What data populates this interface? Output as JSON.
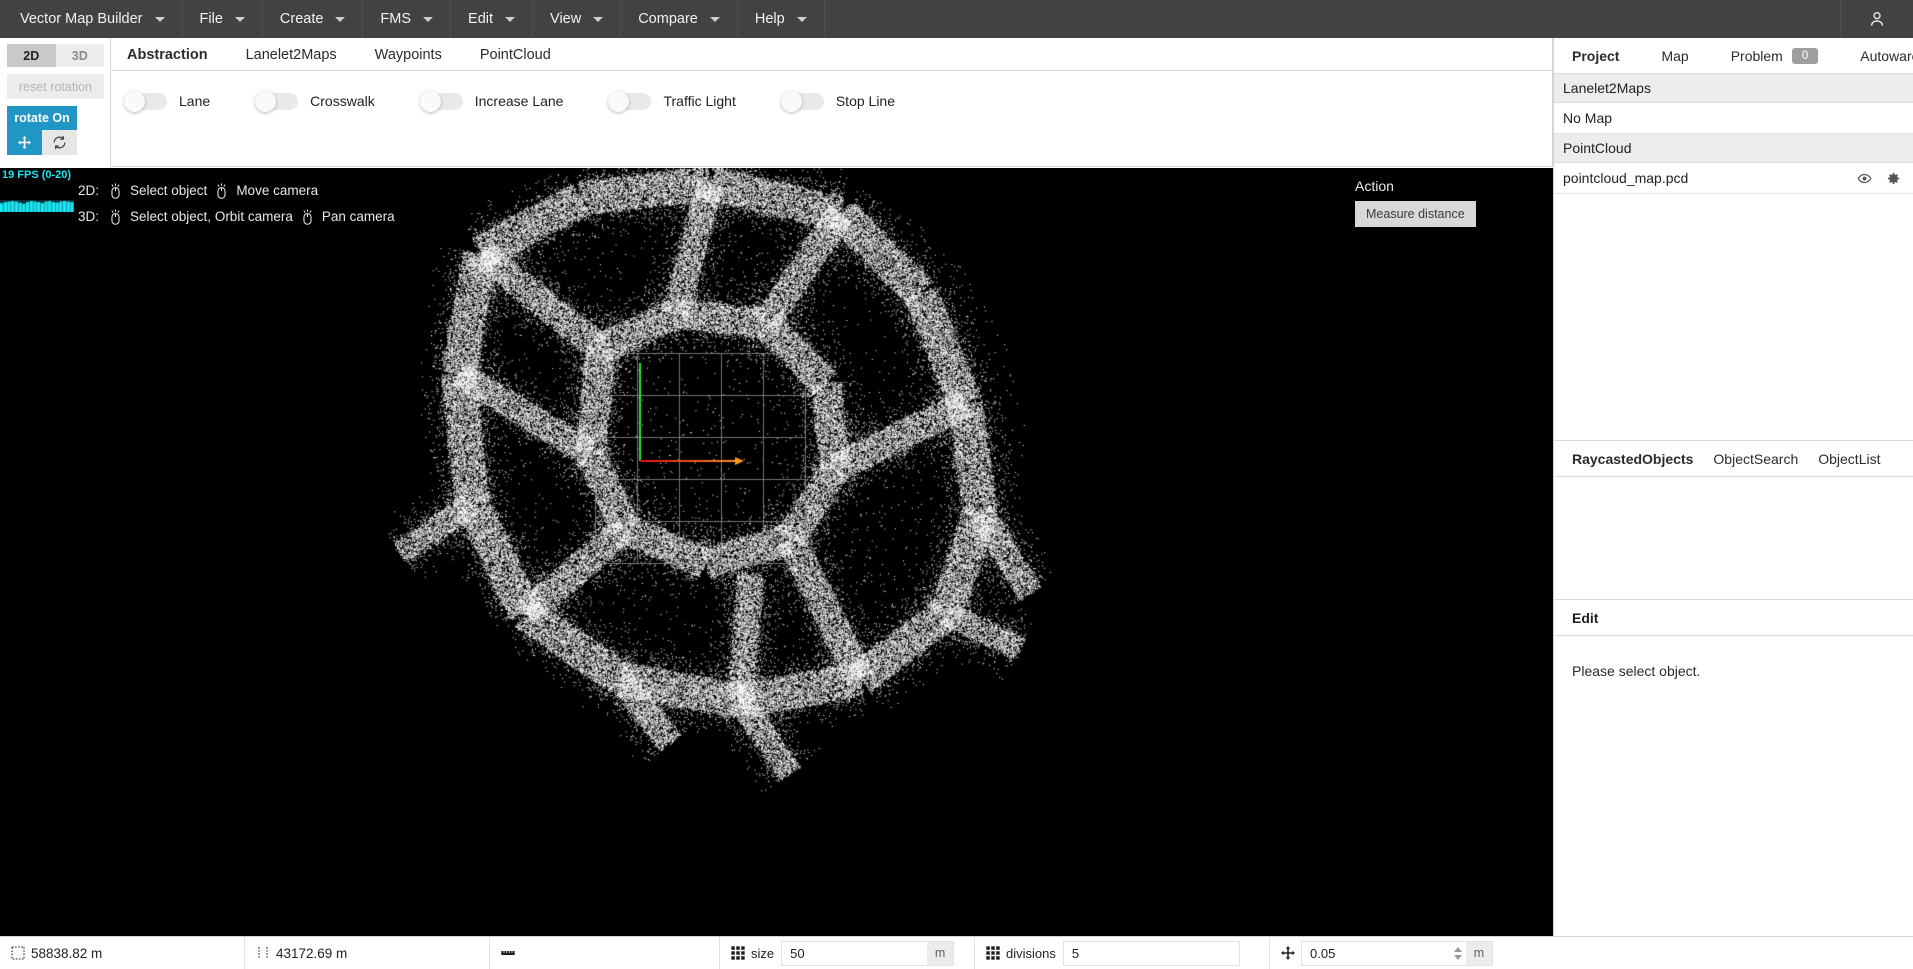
{
  "menubar": {
    "items": [
      {
        "label": "Vector Map Builder",
        "caret": true
      },
      {
        "label": "File",
        "caret": true
      },
      {
        "label": "Create",
        "caret": true
      },
      {
        "label": "FMS",
        "caret": true
      },
      {
        "label": "Edit",
        "caret": true
      },
      {
        "label": "View",
        "caret": true
      },
      {
        "label": "Compare",
        "caret": true
      },
      {
        "label": "Help",
        "caret": true
      }
    ],
    "account_icon": "person-icon"
  },
  "left_controls": {
    "dim_2d": "2D",
    "dim_3d": "3D",
    "active_dim": "2D",
    "reset_rotation": "reset rotation",
    "rotate_toggle": "rotate On",
    "move_icon": "move-arrows-icon",
    "refresh_icon": "refresh-icon"
  },
  "abstraction_panel": {
    "tabs": [
      {
        "label": "Abstraction",
        "active": true
      },
      {
        "label": "Lanelet2Maps",
        "active": false
      },
      {
        "label": "Waypoints",
        "active": false
      },
      {
        "label": "PointCloud",
        "active": false
      }
    ],
    "toggles": [
      {
        "label": "Lane",
        "on": false
      },
      {
        "label": "Crosswalk",
        "on": false
      },
      {
        "label": "Increase Lane",
        "on": false
      },
      {
        "label": "Traffic Light",
        "on": false
      },
      {
        "label": "Stop Line",
        "on": false
      }
    ]
  },
  "viewport": {
    "fps": {
      "text": "19 FPS (0-20)",
      "color": "#19e6f2",
      "samples": [
        16,
        18,
        19,
        20,
        19,
        17,
        15,
        18,
        20,
        19,
        18,
        16,
        19,
        20,
        18,
        17,
        19,
        20,
        19,
        18
      ]
    },
    "hints": [
      {
        "prefix": "2D:",
        "items": [
          "Select object",
          "Move camera"
        ]
      },
      {
        "prefix": "3D:",
        "items": [
          "Select object, Orbit camera",
          "Pan camera"
        ]
      }
    ],
    "action": {
      "title": "Action",
      "measure_distance": "Measure distance"
    },
    "grid": {
      "size": 50,
      "divisions": 5,
      "color": "#8a8a8a"
    },
    "axes": {
      "x_color_start": "#e81010",
      "x_color_end": "#ff9a1f",
      "y_color": "#23e823"
    },
    "pointcloud_color": "#ffffff",
    "background_color": "#000000"
  },
  "sidebar": {
    "project_tabs": [
      {
        "label": "Project",
        "active": true,
        "badge": null
      },
      {
        "label": "Map",
        "active": false,
        "badge": null
      },
      {
        "label": "Problem",
        "active": false,
        "badge": "0"
      },
      {
        "label": "Autoware",
        "active": false,
        "badge": null
      }
    ],
    "project_list": [
      {
        "type": "section",
        "label": "Lanelet2Maps"
      },
      {
        "type": "row",
        "label": "No Map",
        "icons": []
      },
      {
        "type": "section",
        "label": "PointCloud"
      },
      {
        "type": "row",
        "label": "pointcloud_map.pcd",
        "icons": [
          "eye-icon",
          "gear-icon"
        ]
      }
    ],
    "object_tabs": [
      {
        "label": "RaycastedObjects",
        "active": true
      },
      {
        "label": "ObjectSearch",
        "active": false
      },
      {
        "label": "ObjectList",
        "active": false
      }
    ],
    "edit": {
      "title": "Edit",
      "empty_message": "Please select object."
    }
  },
  "statusbar": {
    "cells": [
      {
        "kind": "measure",
        "icon": "area-icon",
        "value": "58838.82 m"
      },
      {
        "kind": "measure",
        "icon": "distance-icon",
        "value": "43172.69 m"
      },
      {
        "kind": "icon_only",
        "icon": "ruler-icon"
      },
      {
        "kind": "field",
        "icon": "grid-icon",
        "label": "size",
        "value": "50",
        "unit": "m",
        "spinner": false
      },
      {
        "kind": "field",
        "icon": "grid-icon",
        "label": "divisions",
        "value": "5",
        "unit": "",
        "spinner": false
      },
      {
        "kind": "field",
        "icon": "move-arrows-icon",
        "label": "",
        "value": "0.05",
        "unit": "m",
        "spinner": true
      }
    ]
  }
}
